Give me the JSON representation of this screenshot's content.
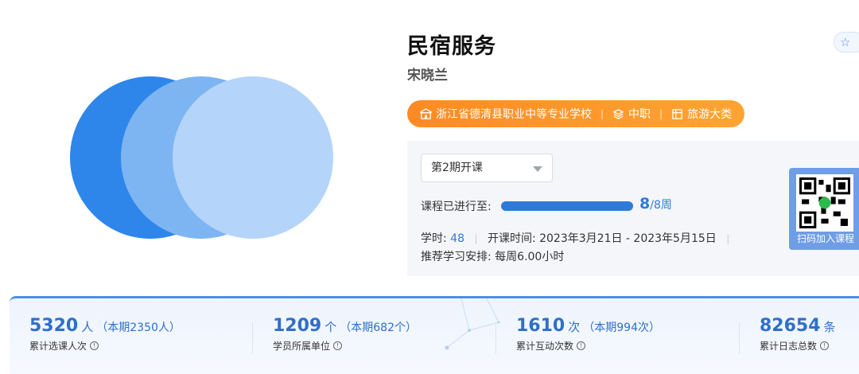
{
  "course": {
    "title": "民宿服务",
    "teacher": "宋晓兰"
  },
  "tags": {
    "school": "浙江省德清县职业中等专业学校",
    "level": "中职",
    "category": "旅游大类"
  },
  "session": {
    "selected": "第2期开课",
    "progress_label": "课程已进行至:",
    "progress_fraction": 1.0,
    "progress_current": "8",
    "progress_total": "/8周",
    "hours_label": "学时:",
    "hours_value": "48",
    "schedule": "开课时间: 2023年3月21日 - 2023年5月15日",
    "recommend": "推荐学习安排: 每周6.00小时"
  },
  "qr": {
    "label": "扫码加入课程"
  },
  "colors": {
    "accent_blue": "#2f7ad9",
    "tag_orange": "#ff8a24",
    "circle_dark": "#2f86ea",
    "circle_mid": "#7db5f3",
    "circle_light": "#b4d4fa"
  },
  "stats": [
    {
      "num": "5320",
      "unit": "人",
      "extra": "（本期2350人）",
      "label": "累计选课人次"
    },
    {
      "num": "1209",
      "unit": "个",
      "extra": "（本期682个）",
      "label": "学员所属单位"
    },
    {
      "num": "1610",
      "unit": "次",
      "extra": "（本期994次）",
      "label": "累计互动次数"
    },
    {
      "num": "82654",
      "unit": "条",
      "extra": "",
      "label": "累计日志总数"
    }
  ]
}
